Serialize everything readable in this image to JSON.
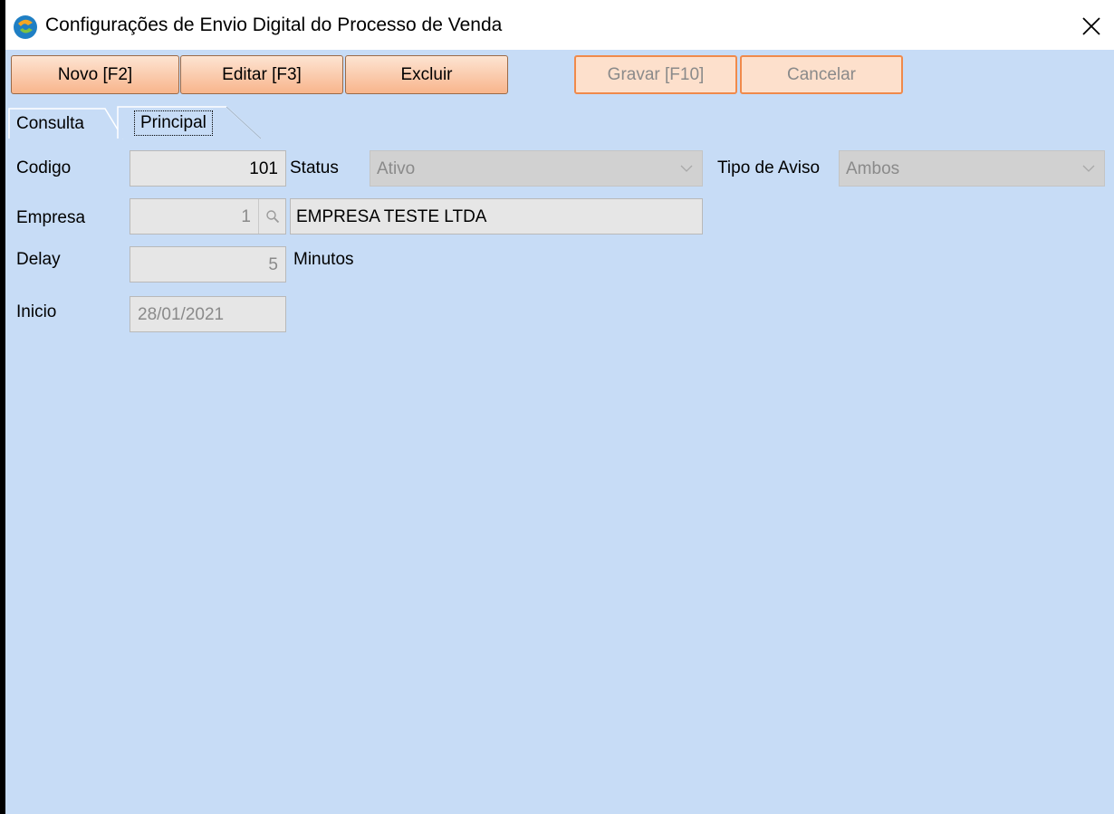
{
  "window": {
    "title": "Configurações de Envio Digital do Processo de Venda"
  },
  "icons": {
    "app": "app-logo-icon",
    "close": "close-icon",
    "lookup": "search-icon",
    "dropdown": "chevron-down-icon"
  },
  "toolbar": {
    "novo_label": "Novo [F2]",
    "editar_label": "Editar [F3]",
    "excluir_label": "Excluir",
    "gravar_label": "Gravar [F10]",
    "cancelar_label": "Cancelar"
  },
  "tabs": {
    "consulta": "Consulta",
    "principal": "Principal"
  },
  "form": {
    "codigo_label": "Codigo",
    "codigo_value": "101",
    "status_label": "Status",
    "status_value": "Ativo",
    "tipo_aviso_label": "Tipo de Aviso",
    "tipo_aviso_value": "Ambos",
    "empresa_label": "Empresa",
    "empresa_code": "1",
    "empresa_name": "EMPRESA TESTE LTDA",
    "delay_label": "Delay",
    "delay_value": "5",
    "delay_unit": "Minutos",
    "inicio_label": "Inicio",
    "inicio_value": "28/01/2021"
  },
  "colors": {
    "background": "#c7dcf6",
    "button_active": "#f8b58c",
    "button_disabled_border": "#f08a4b",
    "field_bg": "#e6e6e6",
    "select_bg": "#d1d1d1"
  }
}
